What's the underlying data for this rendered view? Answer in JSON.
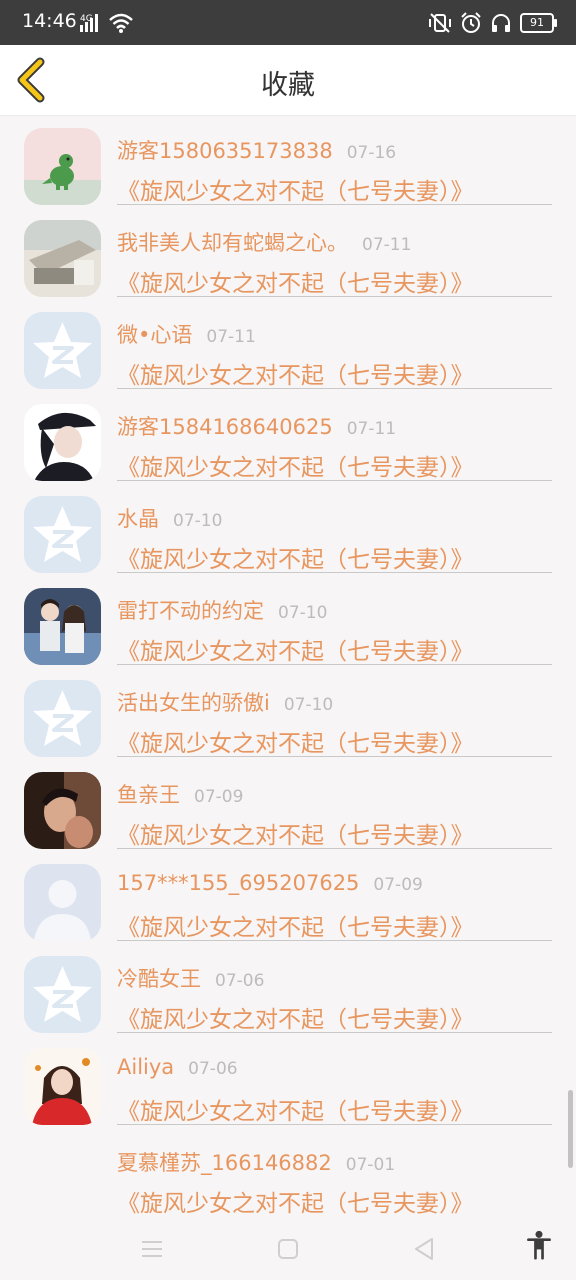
{
  "status_bar": {
    "time": "14:46",
    "network": "4G",
    "battery": "91"
  },
  "header": {
    "title": "收藏",
    "back_icon": "chevron-left-icon"
  },
  "items": [
    {
      "user": "游客1580635173838",
      "date": "07-16",
      "book": "《旋风少女之对不起（七号夫妻）》",
      "avatar": "dinosaur"
    },
    {
      "user": "我非美人却有蛇蝎之心。",
      "date": "07-11",
      "book": "《旋风少女之对不起（七号夫妻）》",
      "avatar": "photo-desk"
    },
    {
      "user": "微•心语",
      "date": "07-11",
      "book": "《旋风少女之对不起（七号夫妻）》",
      "avatar": "qzone"
    },
    {
      "user": "游客1584168640625",
      "date": "07-11",
      "book": "《旋风少女之对不起（七号夫妻）》",
      "avatar": "girl-cap"
    },
    {
      "user": "水晶",
      "date": "07-10",
      "book": "《旋风少女之对不起（七号夫妻）》",
      "avatar": "qzone"
    },
    {
      "user": "雷打不动的约定",
      "date": "07-10",
      "book": "《旋风少女之对不起（七号夫妻）》",
      "avatar": "couple"
    },
    {
      "user": "活出女生的骄傲i",
      "date": "07-10",
      "book": "《旋风少女之对不起（七号夫妻）》",
      "avatar": "qzone"
    },
    {
      "user": "鱼亲王",
      "date": "07-09",
      "book": "《旋风少女之对不起（七号夫妻）》",
      "avatar": "man-portrait"
    },
    {
      "user": "157***155_695207625",
      "date": "07-09",
      "book": "《旋风少女之对不起（七号夫妻）》",
      "avatar": "default-user"
    },
    {
      "user": "冷酷女王",
      "date": "07-06",
      "book": "《旋风少女之对不起（七号夫妻）》",
      "avatar": "qzone"
    },
    {
      "user": "Ailiya",
      "date": "07-06",
      "book": "《旋风少女之对不起（七号夫妻）》",
      "avatar": "girl-red"
    },
    {
      "user": "夏慕槿苏_166146882",
      "date": "07-01",
      "book": "《旋风少女之对不起（七号夫妻）》",
      "avatar": "none"
    }
  ],
  "colors": {
    "accent": "#e8965f",
    "back_icon": "#f5c518",
    "date": "#bcbcbc"
  },
  "nav": {
    "icons": [
      "menu-icon",
      "home-icon",
      "back-triangle-icon",
      "accessibility-icon"
    ]
  }
}
